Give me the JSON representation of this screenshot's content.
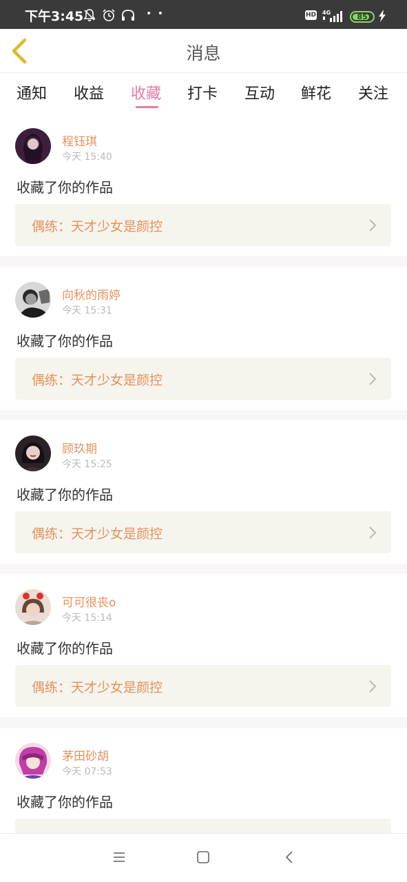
{
  "status_bar": {
    "time": "下午3:45",
    "network": "4G",
    "hd_label": "HD",
    "battery_level": "85",
    "battery_fraction": 0.85,
    "icons": [
      "bell-off-icon",
      "alarm-icon",
      "headset-icon",
      "more-dots-icon",
      "hd-icon",
      "signal-icon",
      "battery-icon",
      "charging-icon"
    ]
  },
  "header": {
    "title": "消息",
    "back_icon": "chevron-left-icon"
  },
  "tabs": [
    {
      "label": "通知",
      "active": false
    },
    {
      "label": "收益",
      "active": false
    },
    {
      "label": "收藏",
      "active": true
    },
    {
      "label": "打卡",
      "active": false
    },
    {
      "label": "互动",
      "active": false
    },
    {
      "label": "鲜花",
      "active": false
    },
    {
      "label": "关注",
      "active": false
    }
  ],
  "feed": [
    {
      "username": "程钰琪",
      "time": "今天 15:40",
      "action": "收藏了你的作品",
      "work_title": "偶练：天才少女是颜控"
    },
    {
      "username": "向秋的雨婷",
      "time": "今天 15:31",
      "action": "收藏了你的作品",
      "work_title": "偶练：天才少女是颜控"
    },
    {
      "username": "顾玖期",
      "time": "今天 15:25",
      "action": "收藏了你的作品",
      "work_title": "偶练：天才少女是颜控"
    },
    {
      "username": "可可很丧o",
      "time": "今天 15:14",
      "action": "收藏了你的作品",
      "work_title": "偶练：天才少女是颜控"
    },
    {
      "username": "茅田砂胡",
      "time": "今天 07:53",
      "action": "收藏了你的作品",
      "work_title": ""
    }
  ],
  "bottom_nav": {
    "icons": [
      "menu-icon",
      "home-square-icon",
      "back-triangle-icon"
    ]
  },
  "colors": {
    "accent_pink": "#e57aa6",
    "username_orange": "#e4925c",
    "card_box_bg": "#f5f4ed",
    "status_bar_bg": "#3a3a3a",
    "back_arrow_yellow": "#e8c33a"
  }
}
